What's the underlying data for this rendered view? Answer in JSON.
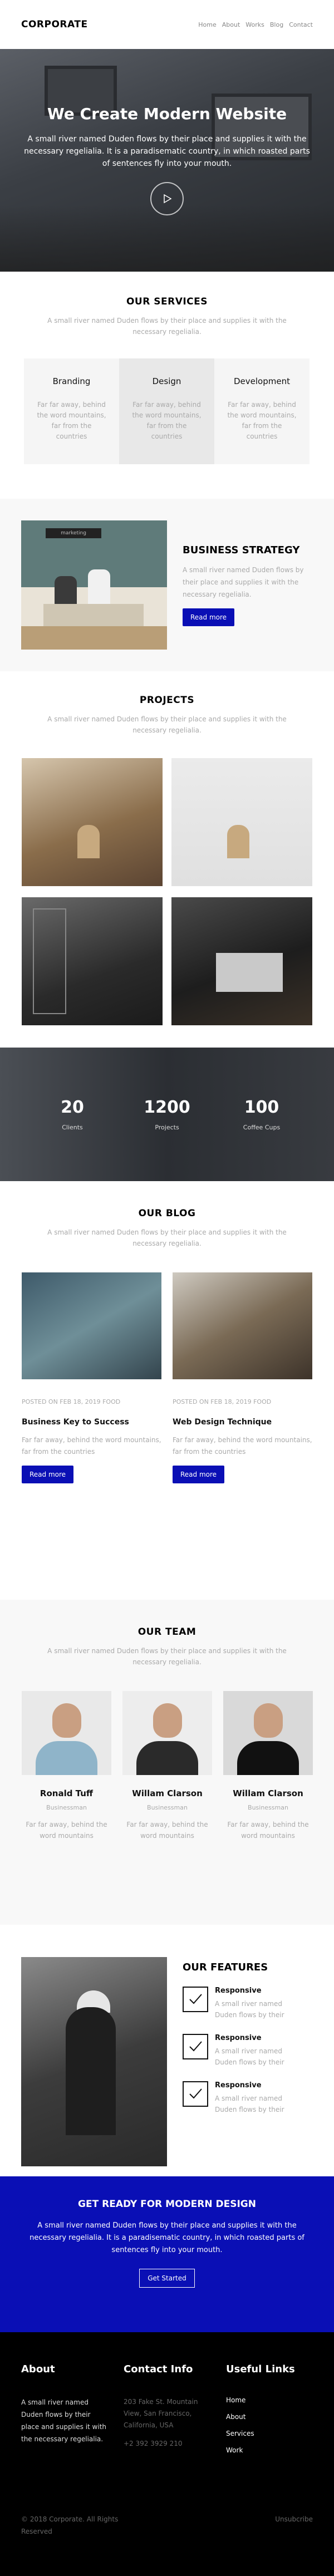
{
  "nav": {
    "brand": "CORPORATE",
    "links": [
      "Home",
      "About",
      "Works",
      "Blog",
      "Contact"
    ]
  },
  "hero": {
    "title": "We Create Modern Website",
    "text": "A small river named Duden flows by their place and supplies it with the necessary regelialia. It is a paradisematic country, in which roasted parts of sentences fly into your mouth.",
    "play_icon": "play-icon"
  },
  "services": {
    "title": "OUR SERVICES",
    "subtitle": "A small river named Duden flows by their place and supplies it with the necessary regelialia.",
    "items": [
      {
        "title": "Branding",
        "text": "Far far away, behind the word mountains, far from the countries"
      },
      {
        "title": "Design",
        "text": "Far far away, behind the word mountains, far from the countries"
      },
      {
        "title": "Development",
        "text": "Far far away, behind the word mountains, far from the countries"
      }
    ]
  },
  "strategy": {
    "sign": "marketing",
    "title": "BUSINESS STRATEGY",
    "text": "A small river named Duden flows by their place and supplies it with the necessary regelialia.",
    "button": "Read more"
  },
  "projects": {
    "title": "PROJECTS",
    "subtitle": "A small river named Duden flows by their place and supplies it with the necessary regelialia."
  },
  "counters": [
    {
      "value": "20",
      "label": "Clients"
    },
    {
      "value": "1200",
      "label": "Projects"
    },
    {
      "value": "100",
      "label": "Coffee Cups"
    }
  ],
  "blog": {
    "title": "OUR BLOG",
    "subtitle": "A small river named Duden flows by their place and supplies it with the necessary regelialia.",
    "posts": [
      {
        "meta": "POSTED ON FEB 18, 2019 FOOD",
        "title": "Business Key to Success",
        "text": "Far far away, behind the word mountains, far from the countries",
        "button": "Read more"
      },
      {
        "meta": "POSTED ON FEB 18, 2019 FOOD",
        "title": "Web Design Technique",
        "text": "Far far away, behind the word mountains, far from the countries",
        "button": "Read more"
      }
    ]
  },
  "team": {
    "title": "OUR TEAM",
    "subtitle": "A small river named Duden flows by their place and supplies it with the necessary regelialia.",
    "members": [
      {
        "name": "Ronald Tuff",
        "role": "Businessman",
        "text": "Far far away, behind the word mountains"
      },
      {
        "name": "Willam Clarson",
        "role": "Businessman",
        "text": "Far far away, behind the word mountains"
      },
      {
        "name": "Willam Clarson",
        "role": "Businessman",
        "text": "Far far away, behind the word mountains"
      }
    ]
  },
  "features": {
    "title": "OUR FEATURES",
    "items": [
      {
        "title": "Responsive",
        "text": "A small river named Duden flows by their"
      },
      {
        "title": "Responsive",
        "text": "A small river named Duden flows by their"
      },
      {
        "title": "Responsive",
        "text": "A small river named Duden flows by their"
      }
    ]
  },
  "cta": {
    "title": "GET READY FOR MODERN DESIGN",
    "text": "A small river named Duden flows by their place and supplies it with the necessary regelialia. It is a paradisematic country, in which roasted parts of sentences fly into your mouth.",
    "button": "Get Started"
  },
  "footer": {
    "about_title": "About",
    "about_text": "A small river named Duden flows by their place and supplies it with the necessary regelialia.",
    "contact_title": "Contact Info",
    "address": "203 Fake St. Mountain View, San Francisco, California, USA",
    "phone": "+2 392 3929 210",
    "links_title": "Useful Links",
    "links": [
      "Home",
      "About",
      "Services",
      "Work"
    ],
    "copyright": "© 2018 Corporate. All Rights Reserved",
    "unsubscribe": "Unsubcribe"
  },
  "colors": {
    "accent": "#0a0fb5",
    "footer_bg": "#000000",
    "muted_text": "#aaaaaa"
  }
}
